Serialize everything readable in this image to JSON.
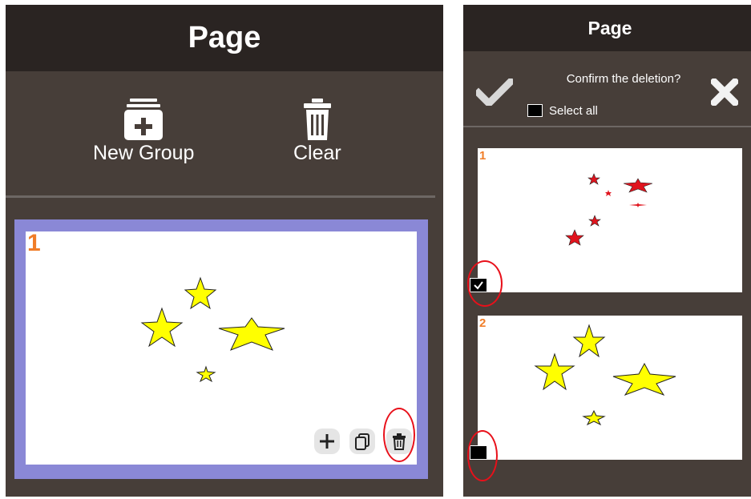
{
  "left_panel": {
    "title": "Page",
    "toolbar": {
      "new_group_label": "New Group",
      "clear_label": "Clear"
    },
    "page_thumb": {
      "number": "1"
    },
    "thumb_actions": [
      "plus-icon",
      "copy-icon",
      "trash-icon"
    ]
  },
  "right_panel": {
    "title": "Page",
    "confirm": {
      "question": "Confirm the deletion?",
      "select_all_label": "Select all",
      "select_all_checked": false,
      "accept_icon": "check-icon",
      "cancel_icon": "close-icon"
    },
    "pages": [
      {
        "number": "1",
        "checked": true
      },
      {
        "number": "2",
        "checked": false
      }
    ]
  },
  "colors": {
    "panel": "#473e39",
    "header": "#2a2422",
    "selection": "#8a88d6",
    "page_number": "#f07d28",
    "highlight": "#e8101a",
    "star_yellow": "#ffff00",
    "star_red": "#e0141e"
  }
}
